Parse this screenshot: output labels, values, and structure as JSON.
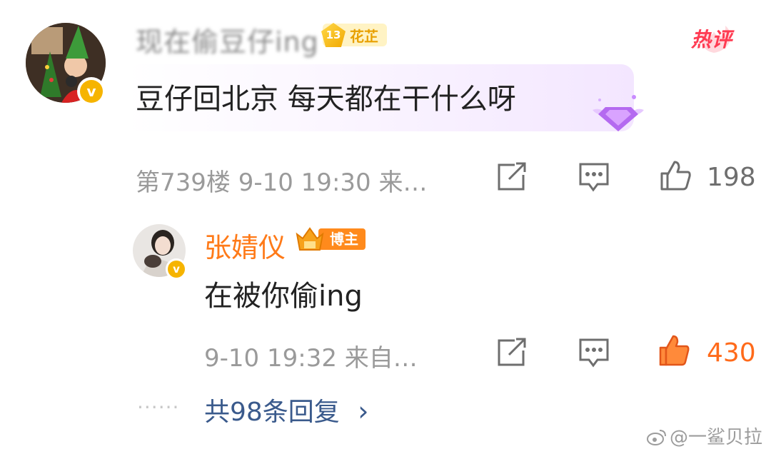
{
  "comment": {
    "username_visible": "现在偷豆仔ing",
    "level_badge": {
      "level": "13",
      "label": "花芷"
    },
    "hot_label": "热评",
    "text": "豆仔回北京 每天都在干什么呀",
    "meta": "第739楼 9-10 19:30 来…",
    "like_count": "198"
  },
  "reply": {
    "username": "张婧仪",
    "badge_label": "博主",
    "text": "在被你偷ing",
    "meta": "9-10 19:32 来自…",
    "like_count": "430"
  },
  "more_replies": {
    "dots": "······",
    "label": "共98条回复",
    "chevron": "›"
  },
  "watermark": "@一鲨贝拉",
  "colors": {
    "accent_orange": "#ff7a18",
    "hot_red": "#ff3b52",
    "link_blue": "#3a5a8c",
    "verified_gold": "#f6b400"
  },
  "icons": {
    "share": "share-icon",
    "comment": "comment-icon",
    "like": "thumbs-up-icon",
    "verified": "verified-v-icon",
    "vip_gem": "gem-icon",
    "weibo_logo": "weibo-logo-icon"
  }
}
